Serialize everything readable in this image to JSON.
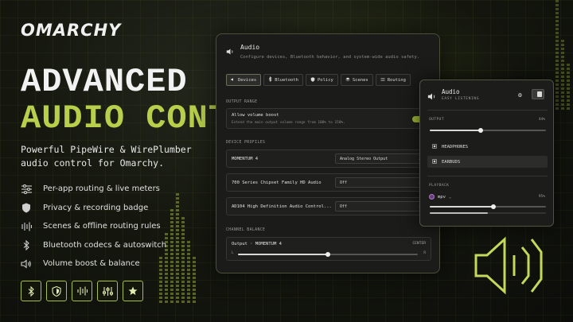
{
  "brand": {
    "logo": "OMARCHY"
  },
  "hero": {
    "line1": "ADVANCED",
    "line2": "AUDIO CONTROL",
    "tagline": "Powerful PipeWire & WirePlumber audio control for Omarchy."
  },
  "features": [
    {
      "icon": "sliders-icon",
      "label": "Per-app routing & live meters"
    },
    {
      "icon": "shield-icon",
      "label": "Privacy & recording badge"
    },
    {
      "icon": "layers-icon",
      "label": "Scenes & offline routing rules"
    },
    {
      "icon": "bluetooth-icon",
      "label": "Bluetooth codecs & autoswitch"
    },
    {
      "icon": "speaker-icon",
      "label": "Volume boost & balance"
    }
  ],
  "badges": [
    "bluetooth-icon",
    "shield-icon",
    "waveform-icon",
    "equalizer-icon",
    "star-icon"
  ],
  "window": {
    "title": "Audio",
    "subtitle": "Configure devices, Bluetooth behavior, and system-wide audio safety.",
    "tabs": [
      "Devices",
      "Bluetooth",
      "Policy",
      "Scenes",
      "Routing"
    ],
    "output_range_label": "OUTPUT RANGE",
    "boost_title": "Allow volume boost",
    "boost_desc": "Extend the main output volume range from 100% to 150%.",
    "boost_enabled": true,
    "device_profiles_label": "DEVICE PROFILES",
    "profiles": [
      {
        "device": "MOMENTUM 4",
        "value": "Analog Stereo Output"
      },
      {
        "device": "700 Series Chipset Family HD Audio",
        "value": "Off"
      },
      {
        "device": "AD104 High Definition Audio Control...",
        "value": "Off"
      }
    ],
    "balance_label": "CHANNEL BALANCE",
    "balance_title": "Output · MOMENTUM 4",
    "balance_center": "CENTER",
    "balance_left": "L",
    "balance_right": "R",
    "balance_value": 0.5
  },
  "popup": {
    "title": "Audio",
    "subtitle": "EASY LISTENING",
    "output_label": "OUTPUT",
    "output_percent": "44%",
    "output_level": 0.44,
    "devices": [
      "HEADPHONES",
      "EARBUDS"
    ],
    "selected_device": "EARBUDS",
    "playback_label": "PLAYBACK",
    "app_name": "mpv",
    "app_percent": "95%",
    "app_level": 0.55,
    "app_meter": 0.5
  },
  "colors": {
    "accent": "#b7cf4a",
    "bg": "#15170f"
  }
}
